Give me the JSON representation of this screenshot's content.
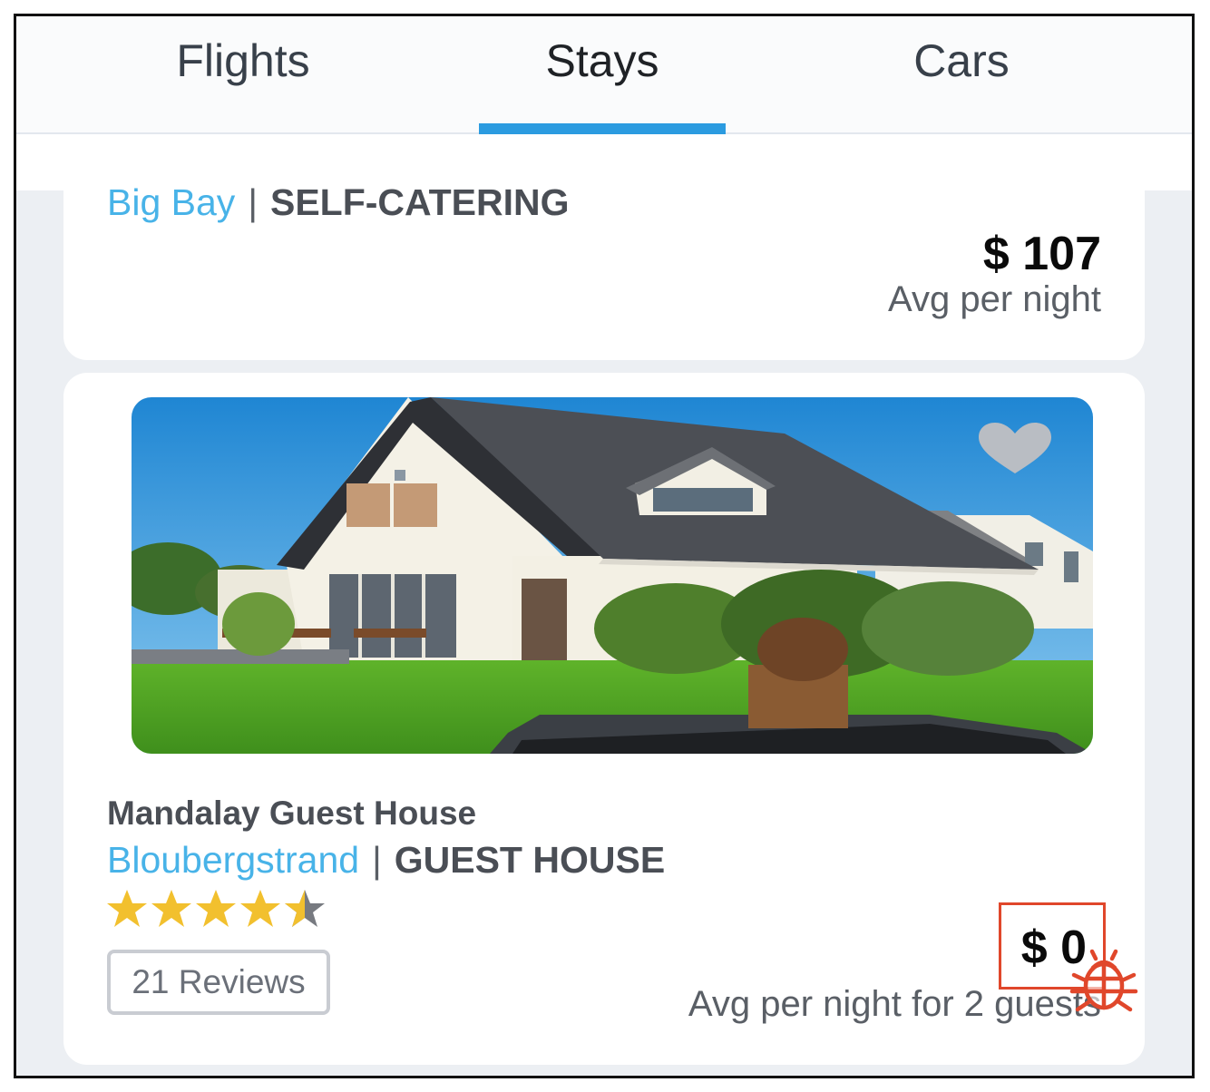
{
  "tabs": [
    {
      "label": "Flights",
      "active": false
    },
    {
      "label": "Stays",
      "active": true
    },
    {
      "label": "Cars",
      "active": false
    }
  ],
  "listings": [
    {
      "city": "Big Bay",
      "separator": "|",
      "type": "SELF-CATERING",
      "price": "$ 107",
      "price_note": "Avg per night"
    },
    {
      "name": "Mandalay Guest House",
      "city": "Bloubergstrand",
      "separator": "|",
      "type": "GUEST HOUSE",
      "rating": 4.5,
      "rating_max": 5,
      "reviews": "21 Reviews",
      "price": "$ 0",
      "price_note": "Avg per night for 2 guests",
      "favorite_icon": "heart-icon",
      "photo": "house-photo"
    }
  ],
  "colors": {
    "accent": "#2b9be0",
    "city_link": "#48b3e8",
    "star": "#f2c02e",
    "annotation": "#e0472b"
  },
  "annotation_icon": "bug-icon"
}
